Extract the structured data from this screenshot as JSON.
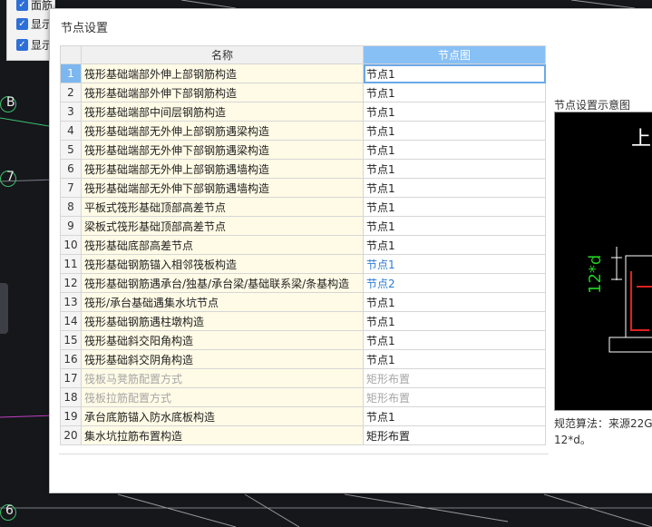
{
  "background": {
    "checkboxes": [
      {
        "label": "面筋"
      },
      {
        "label": "显示"
      },
      {
        "label": "显示"
      }
    ],
    "axis_labels": {
      "b": "B",
      "seven": "7",
      "six": "6"
    }
  },
  "dialog": {
    "title": "节点设置",
    "columns": {
      "name": "名称",
      "node": "节点图"
    },
    "rows": [
      {
        "num": "1",
        "name": "筏形基础端部外伸上部钢筋构造",
        "node": "节点1"
      },
      {
        "num": "2",
        "name": "筏形基础端部外伸下部钢筋构造",
        "node": "节点1"
      },
      {
        "num": "3",
        "name": "筏形基础端部中间层钢筋构造",
        "node": "节点1"
      },
      {
        "num": "4",
        "name": "筏形基础端部无外伸上部钢筋遇梁构造",
        "node": "节点1"
      },
      {
        "num": "5",
        "name": "筏形基础端部无外伸下部钢筋遇梁构造",
        "node": "节点1"
      },
      {
        "num": "6",
        "name": "筏形基础端部无外伸上部钢筋遇墙构造",
        "node": "节点1"
      },
      {
        "num": "7",
        "name": "筏形基础端部无外伸下部钢筋遇墙构造",
        "node": "节点1"
      },
      {
        "num": "8",
        "name": "平板式筏形基础顶部高差节点",
        "node": "节点1"
      },
      {
        "num": "9",
        "name": "梁板式筏形基础顶部高差节点",
        "node": "节点1"
      },
      {
        "num": "10",
        "name": "筏形基础底部高差节点",
        "node": "节点1"
      },
      {
        "num": "11",
        "name": "筏形基础钢筋锚入相邻筏板构造",
        "node": "节点1"
      },
      {
        "num": "12",
        "name": "筏形基础钢筋遇承台/独基/承台梁/基础联系梁/条基构造",
        "node": "节点2"
      },
      {
        "num": "13",
        "name": "筏形/承台基础遇集水坑节点",
        "node": "节点1"
      },
      {
        "num": "14",
        "name": "筏形基础钢筋遇柱墩构造",
        "node": "节点1"
      },
      {
        "num": "15",
        "name": "筏形基础斜交阳角构造",
        "node": "节点1"
      },
      {
        "num": "16",
        "name": "筏形基础斜交阴角构造",
        "node": "节点1"
      },
      {
        "num": "17",
        "name": "筏板马凳筋配置方式",
        "node": "矩形布置"
      },
      {
        "num": "18",
        "name": "筏板拉筋配置方式",
        "node": "矩形布置"
      },
      {
        "num": "19",
        "name": "承台底筋锚入防水底板构造",
        "node": "节点1"
      },
      {
        "num": "20",
        "name": "集水坑拉筋布置构造",
        "node": "矩形布置"
      }
    ],
    "preview": {
      "label": "节点设置示意图",
      "diagram_text_top": "上部",
      "diagram_dim": "12*d",
      "footer_line1": "规范算法：来源22G",
      "footer_line2": "12*d。"
    }
  },
  "colors": {
    "header_accent": "#87c0f5",
    "link_blue": "#2b7bd6",
    "name_cell_bg": "#fffbe6",
    "dim_green": "#22cc22"
  }
}
